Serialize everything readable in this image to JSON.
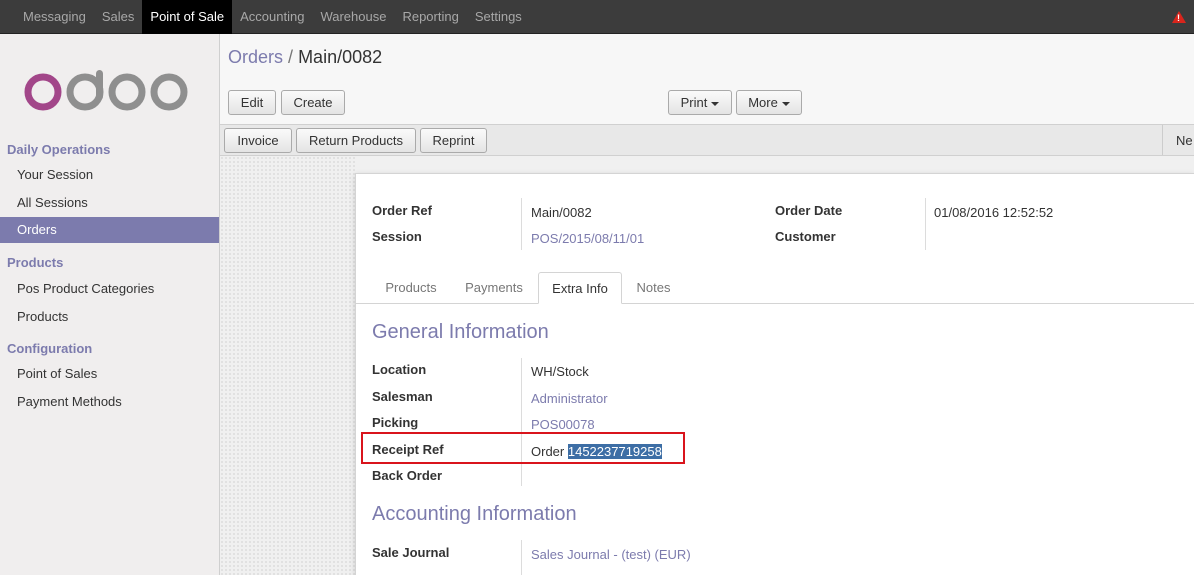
{
  "topbar": {
    "menu": [
      "Messaging",
      "Sales",
      "Point of Sale",
      "Accounting",
      "Warehouse",
      "Reporting",
      "Settings"
    ],
    "active_index": 2,
    "warning_icon": "warning-triangle-icon"
  },
  "logo_text": "odoo",
  "sidebar": {
    "sections": [
      {
        "title": "Daily Operations",
        "items": [
          "Your Session",
          "All Sessions",
          "Orders"
        ]
      },
      {
        "title": "Products",
        "items": [
          "Pos Product Categories",
          "Products"
        ]
      },
      {
        "title": "Configuration",
        "items": [
          "Point of Sales",
          "Payment Methods"
        ]
      }
    ],
    "active_item": "Orders"
  },
  "breadcrumb": {
    "parent": "Orders",
    "separator": "/",
    "current": "Main/0082"
  },
  "buttons": {
    "edit": "Edit",
    "create": "Create",
    "print": "Print",
    "more": "More",
    "invoice": "Invoice",
    "return_products": "Return Products",
    "reprint": "Reprint",
    "new_partial": "Ne"
  },
  "header_fields": {
    "order_ref_label": "Order Ref",
    "order_ref_value": "Main/0082",
    "session_label": "Session",
    "session_value": "POS/2015/08/11/01",
    "order_date_label": "Order Date",
    "order_date_value": "01/08/2016 12:52:52",
    "customer_label": "Customer",
    "customer_value": ""
  },
  "tabs": [
    "Products",
    "Payments",
    "Extra Info",
    "Notes"
  ],
  "active_tab": "Extra Info",
  "general": {
    "title": "General Information",
    "location_label": "Location",
    "location_value": "WH/Stock",
    "salesman_label": "Salesman",
    "salesman_value": "Administrator",
    "picking_label": "Picking",
    "picking_value": "POS00078",
    "receipt_label": "Receipt Ref",
    "receipt_prefix": "Order",
    "receipt_number": "1452237719258",
    "back_order_label": "Back Order"
  },
  "accounting": {
    "title": "Accounting Information",
    "sale_journal_label": "Sale Journal",
    "sale_journal_value": "Sales Journal - (test) (EUR)"
  },
  "colors": {
    "accent": "#7c7bad",
    "topbar": "#3c3c3c",
    "highlight": "#d9141c",
    "selection": "#3d6ea5"
  }
}
